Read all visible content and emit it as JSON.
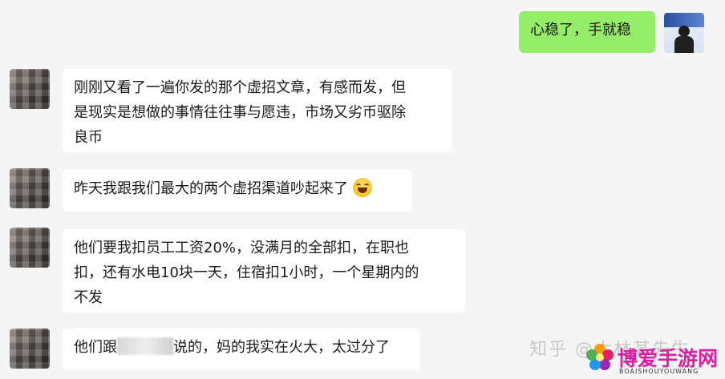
{
  "messages": [
    {
      "side": "right",
      "text": "心稳了，手就稳"
    },
    {
      "side": "left",
      "lines": [
        "刚刚又看了一遍你发的那个虚招文章，有感而发，但",
        "是现实是想做的事情往往事与愿违，市场又劣币驱除",
        "良币"
      ]
    },
    {
      "side": "left",
      "text": "昨天我跟我们最大的两个虚招渠道吵起来了",
      "emoji": "laughing-tears-emoji"
    },
    {
      "side": "left",
      "lines": [
        "他们要我扣员工工资20%，没满月的全部扣，在职也",
        "扣，还有水电10块一天，住宿扣1小时，一个星期内的",
        "不发"
      ]
    },
    {
      "side": "left",
      "text_before": "他们跟",
      "text_after": "说的，妈的我实在火大，太过分了"
    }
  ],
  "watermark": "知乎 @大林某先生",
  "brand": {
    "name": "博爱手游网",
    "url": "BOAISHOUYOUWANG"
  },
  "colors": {
    "background": "#f5f5f5",
    "bubble_left": "#ffffff",
    "bubble_right": "#95ec69"
  }
}
